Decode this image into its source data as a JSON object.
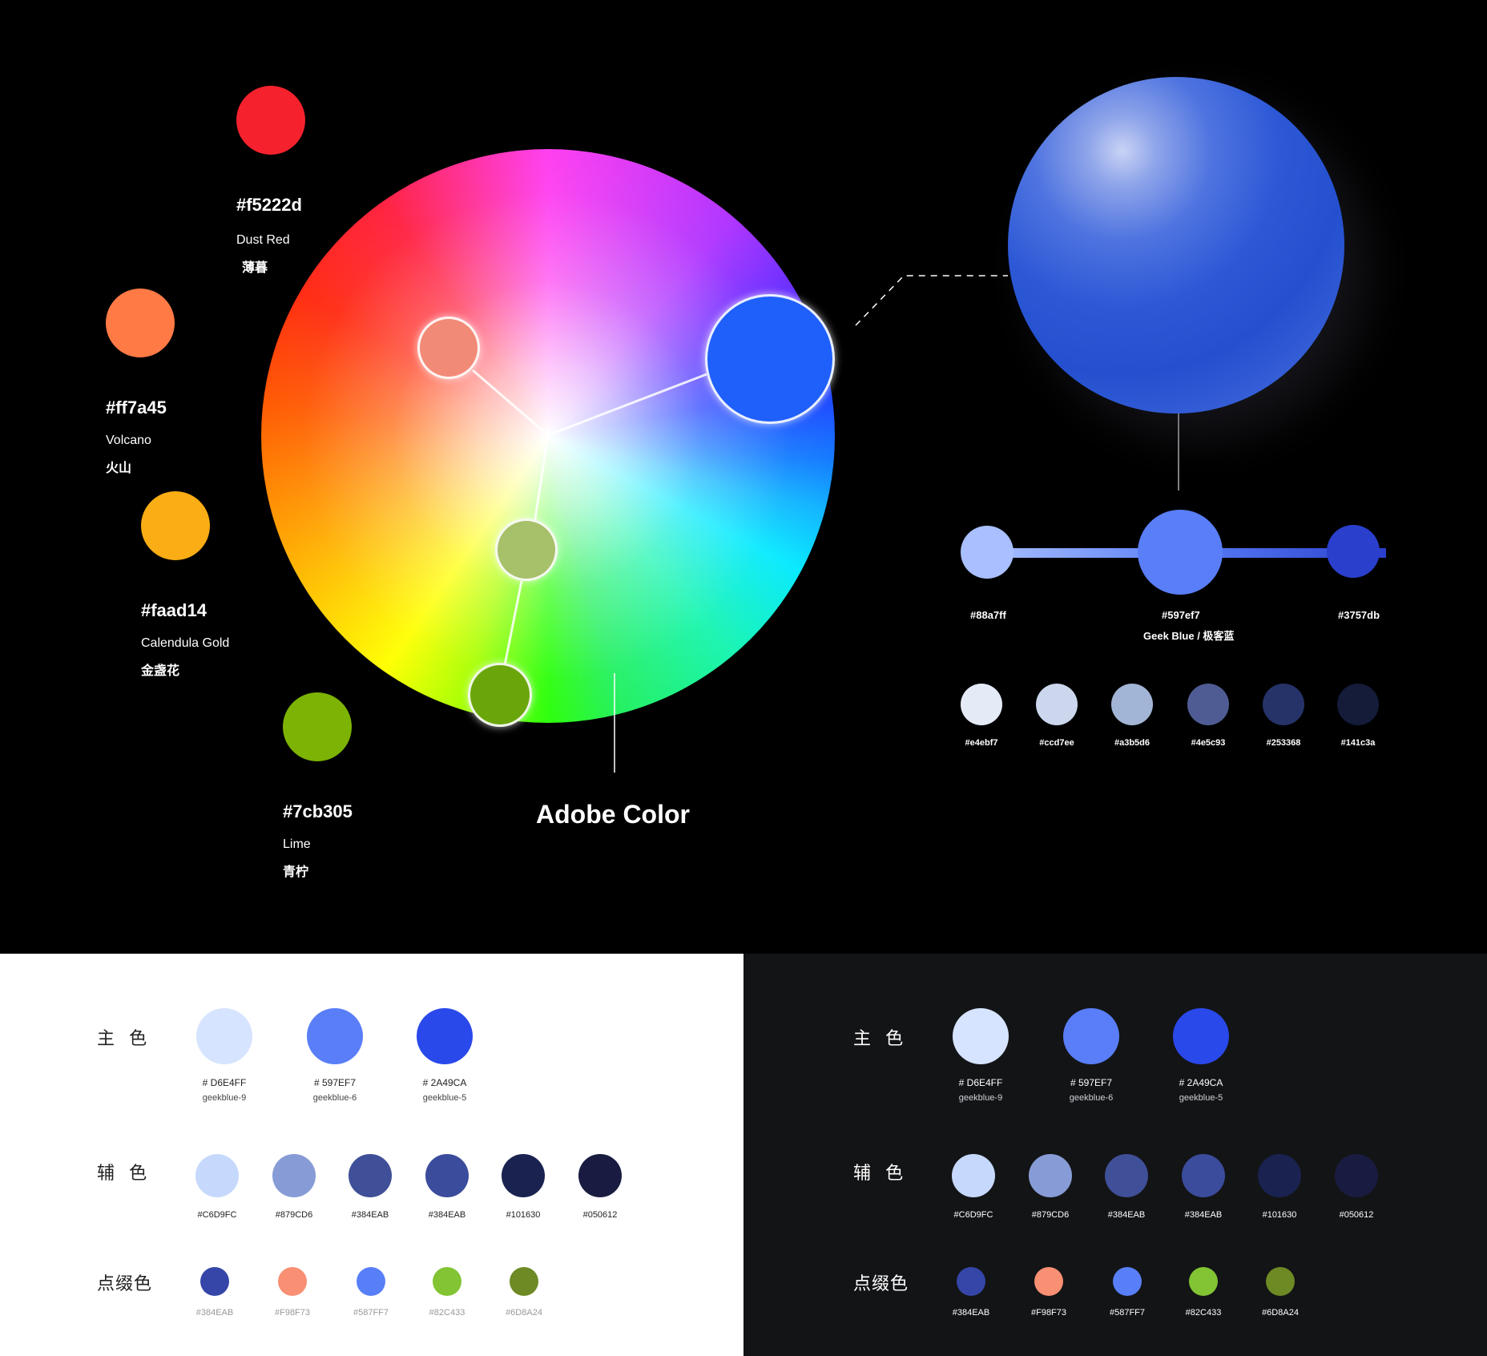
{
  "palette_left": [
    {
      "hex": "#f5222d",
      "en": "Dust Red",
      "zh": "薄暮",
      "color": "#f5222d"
    },
    {
      "hex": "#ff7a45",
      "en": "Volcano",
      "zh": "火山",
      "color": "#ff7a45"
    },
    {
      "hex": "#faad14",
      "en": "Calendula Gold",
      "zh": "金盏花",
      "color": "#faad14"
    },
    {
      "hex": "#7cb305",
      "en": "Lime",
      "zh": "青柠",
      "color": "#7cb305"
    }
  ],
  "wheel": {
    "title": "Adobe Color",
    "nodes": [
      {
        "color": "#f28a78"
      },
      {
        "color": "#1f5ffa"
      },
      {
        "color": "#a7c06a"
      },
      {
        "color": "#6aa60a"
      }
    ]
  },
  "geek_blue": {
    "sphere_color": "#2c58d6",
    "scale": [
      {
        "hex": "#88a7ff",
        "color": "#a9bfff"
      },
      {
        "hex": "#597ef7",
        "color": "#597ef7"
      },
      {
        "hex": "#3757db",
        "color": "#2a3fcc"
      }
    ],
    "name": "Geek Blue / 极客蓝",
    "shades": [
      {
        "hex": "#e4ebf7",
        "color": "#e4ebf7"
      },
      {
        "hex": "#ccd7ee",
        "color": "#ccd7ee"
      },
      {
        "hex": "#a3b5d6",
        "color": "#a3b5d6"
      },
      {
        "hex": "#4e5c93",
        "color": "#4e5c93"
      },
      {
        "hex": "#253368",
        "color": "#253368"
      },
      {
        "hex": "#141c3a",
        "color": "#141c3a"
      }
    ]
  },
  "panels": {
    "labels": {
      "primary": "主 色",
      "secondary": "辅 色",
      "accent": "点缀色"
    },
    "primary": [
      {
        "hex": "# D6E4FF",
        "name": "geekblue-9",
        "color": "#d6e4ff"
      },
      {
        "hex": "# 597EF7",
        "name": "geekblue-6",
        "color": "#597ef7"
      },
      {
        "hex": "# 2A49CA",
        "name": "geekblue-5",
        "color": "#2a49ea"
      }
    ],
    "secondary": [
      {
        "hex": "#C6D9FC",
        "color": "#c6d9fc"
      },
      {
        "hex": "#879CD6",
        "color": "#879cd6"
      },
      {
        "hex": "#384EAB",
        "color": "#3f4f98"
      },
      {
        "hex": "#384EAB",
        "color": "#3b4c9c"
      },
      {
        "hex": "#101630",
        "color": "#1a2250"
      },
      {
        "hex": "#050612",
        "color": "#191c40"
      }
    ],
    "accent": [
      {
        "hex": "#384EAB",
        "color": "#3546a8"
      },
      {
        "hex": "#F98F73",
        "color": "#f98f73"
      },
      {
        "hex": "#587FF7",
        "color": "#587ff7"
      },
      {
        "hex": "#82C433",
        "color": "#82c433"
      },
      {
        "hex": "#6D8A24",
        "color": "#6d8a24"
      }
    ]
  }
}
